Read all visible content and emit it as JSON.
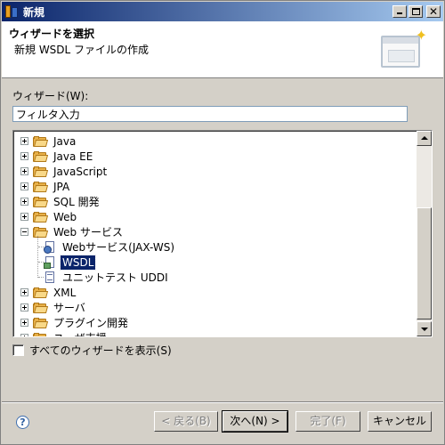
{
  "window": {
    "title": "新規"
  },
  "banner": {
    "title": "ウィザードを選択",
    "description": "新規 WSDL ファイルの作成"
  },
  "wizards": {
    "label": "ウィザード(W):",
    "filter_value": "フィルタ入力"
  },
  "tree": {
    "items": [
      {
        "label": "Java",
        "expanded": false
      },
      {
        "label": "Java EE",
        "expanded": false
      },
      {
        "label": "JavaScript",
        "expanded": false
      },
      {
        "label": "JPA",
        "expanded": false
      },
      {
        "label": "SQL 開発",
        "expanded": false
      },
      {
        "label": "Web",
        "expanded": false
      },
      {
        "label": "Web サービス",
        "expanded": true
      },
      {
        "label": "Webサービス(JAX-WS)",
        "child": true
      },
      {
        "label": "WSDL",
        "child": true,
        "selected": true
      },
      {
        "label": "ユニットテスト UDDI",
        "child": true
      },
      {
        "label": "XML",
        "expanded": false
      },
      {
        "label": "サーバ",
        "expanded": false
      },
      {
        "label": "プラグイン開発",
        "expanded": false
      },
      {
        "label": "ユーザ支援",
        "expanded": false
      }
    ]
  },
  "show_all": {
    "label": "すべてのウィザードを表示(S)",
    "checked": false
  },
  "buttons": {
    "back": "< 戻る(B)",
    "next": "次へ(N) >",
    "finish": "完了(F)",
    "cancel": "キャンセル"
  },
  "help": {
    "glyph": "?"
  }
}
